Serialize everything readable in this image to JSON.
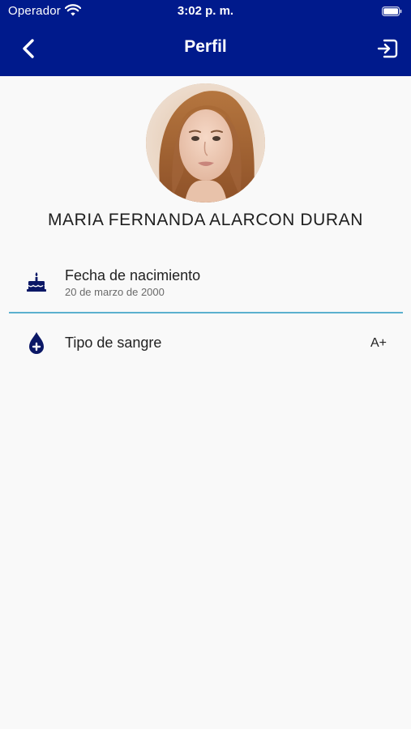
{
  "status_bar": {
    "carrier": "Operador",
    "time": "3:02 p. m."
  },
  "header": {
    "title": "Perfil",
    "back_icon": "chevron-left-icon",
    "logout_icon": "logout-icon"
  },
  "profile": {
    "name": "MARIA FERNANDA ALARCON DURAN"
  },
  "details": {
    "birthdate": {
      "icon": "cake-icon",
      "label": "Fecha de nacimiento",
      "value": "20 de marzo de 2000"
    },
    "blood_type": {
      "icon": "blood-drop-icon",
      "label": "Tipo de sangre",
      "value": "A+"
    }
  },
  "colors": {
    "header_bg": "#001a8c",
    "icon_color": "#0b1866",
    "divider": "#5bb0cf",
    "background": "#f9f9f9"
  }
}
